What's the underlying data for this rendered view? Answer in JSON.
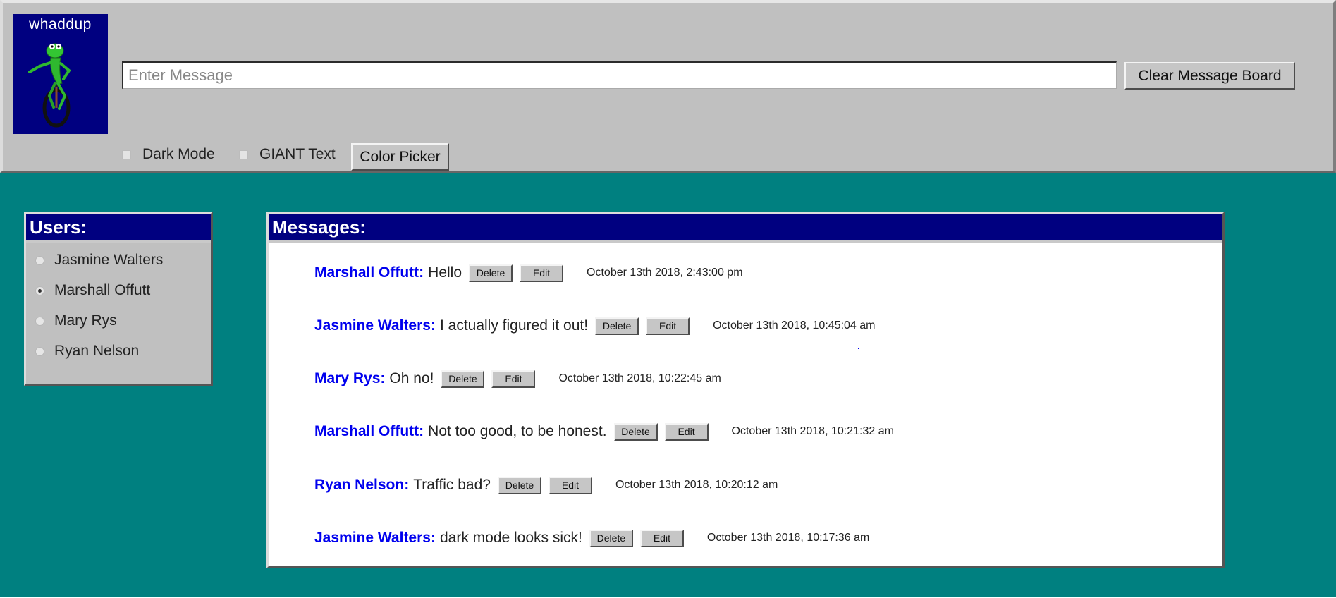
{
  "header": {
    "logo": {
      "title": "whaddup",
      "icon": "frog-on-unicycle-icon",
      "bg_color": "#000080"
    },
    "message_input": {
      "placeholder": "Enter Message",
      "value": ""
    },
    "clear_button_label": "Clear Message Board",
    "options": {
      "dark_mode": {
        "label": "Dark Mode",
        "checked": false
      },
      "giant_text": {
        "label": "GIANT Text",
        "checked": false
      }
    },
    "color_picker_label": "Color Picker"
  },
  "users_panel": {
    "title": "Users:",
    "users": [
      {
        "name": "Jasmine Walters",
        "selected": false
      },
      {
        "name": "Marshall Offutt",
        "selected": true
      },
      {
        "name": "Mary Rys",
        "selected": false
      },
      {
        "name": "Ryan Nelson",
        "selected": false
      }
    ]
  },
  "messages_panel": {
    "title": "Messages:",
    "delete_label": "Delete",
    "edit_label": "Edit",
    "messages": [
      {
        "author": "Marshall Offutt:",
        "text": "Hello",
        "timestamp": "October 13th 2018, 2:43:00 pm"
      },
      {
        "author": "Jasmine Walters:",
        "text": "I actually figured it out!",
        "timestamp": "October 13th 2018, 10:45:04 am"
      },
      {
        "author": "Mary Rys:",
        "text": "Oh no!",
        "timestamp": "October 13th 2018, 10:22:45 am"
      },
      {
        "author": "Marshall Offutt:",
        "text": "Not too good, to be honest.",
        "timestamp": "October 13th 2018, 10:21:32 am"
      },
      {
        "author": "Ryan Nelson:",
        "text": "Traffic bad?",
        "timestamp": "October 13th 2018, 10:20:12 am"
      },
      {
        "author": "Jasmine Walters:",
        "text": "dark mode looks sick!",
        "timestamp": "October 13th 2018, 10:17:36 am"
      }
    ]
  },
  "colors": {
    "header_bg": "#c0c0c0",
    "page_bg": "#008080",
    "title_bar": "#000080",
    "author_text": "#0000ee"
  }
}
